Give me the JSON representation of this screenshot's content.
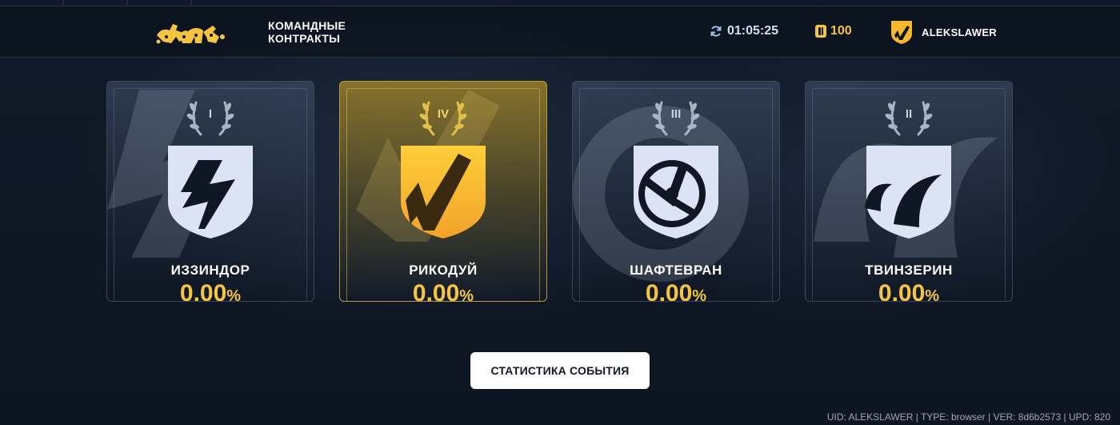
{
  "header": {
    "mode_title_line1": "КОМАНДНЫЕ",
    "mode_title_line2": "КОНТРАКТЫ",
    "timer": "01:05:25",
    "coins": "100",
    "username": "ALEKSLAWER"
  },
  "teams": [
    {
      "rank": "I",
      "name": "ИЗЗИНДОР",
      "value": "0.00",
      "unit": "%",
      "active": false
    },
    {
      "rank": "IV",
      "name": "РИКОДУЙ",
      "value": "0.00",
      "unit": "%",
      "active": true
    },
    {
      "rank": "III",
      "name": "ШАФТЕВРАН",
      "value": "0.00",
      "unit": "%",
      "active": false
    },
    {
      "rank": "II",
      "name": "ТВИНЗЕРИН",
      "value": "0.00",
      "unit": "%",
      "active": false
    }
  ],
  "stats_button": "СТАТИСТИКА СОБЫТИЯ",
  "footer": "UID: ALEKSLAWER | TYPE: browser | VER: 8d6b2573 | UPD: 820",
  "colors": {
    "accent_gold": "#f5c542",
    "background": "#0f1724",
    "emblem_light": "#dbe3f5",
    "emblem_gold": "#f5b82e"
  },
  "icons": {
    "logo": "game-logo",
    "timer": "refresh-icon",
    "coins": "coin-icon",
    "avatar": "team-emblem-avatar"
  }
}
